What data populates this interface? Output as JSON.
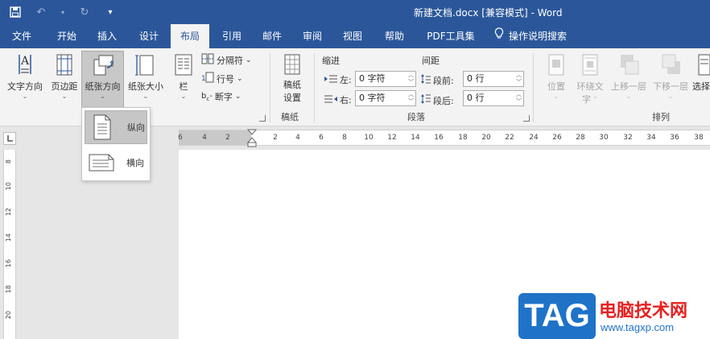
{
  "title_bar": {
    "title": "新建文档.docx [兼容模式]  -  Word",
    "icons": [
      "save-icon",
      "undo-icon",
      "redo-icon",
      "customize-qat-icon"
    ]
  },
  "tabs": [
    {
      "label": "文件"
    },
    {
      "label": "开始"
    },
    {
      "label": "插入"
    },
    {
      "label": "设计"
    },
    {
      "label": "布局"
    },
    {
      "label": "引用"
    },
    {
      "label": "邮件"
    },
    {
      "label": "审阅"
    },
    {
      "label": "视图"
    },
    {
      "label": "帮助"
    },
    {
      "label": "PDF工具集"
    },
    {
      "label": "操作说明搜索"
    }
  ],
  "active_tab": "布局",
  "ribbon": {
    "page_setup": {
      "text_direction": "文字方向",
      "margins": "页边距",
      "orientation": "纸张方向",
      "size": "纸张大小",
      "columns": "栏",
      "breaks": "分隔符",
      "line_numbers": "行号",
      "hyphenation": "断字"
    },
    "manuscript": {
      "button": "稿纸\n设置",
      "button_line1": "稿纸",
      "button_line2": "设置",
      "group_label": "稿纸"
    },
    "paragraph": {
      "indent_header": "缩进",
      "spacing_header": "间距",
      "left_label": "左:",
      "right_label": "右:",
      "before_label": "段前:",
      "after_label": "段后:",
      "left_value": "0 字符",
      "right_value": "0 字符",
      "before_value": "0 行",
      "after_value": "0 行",
      "group_label": "段落"
    },
    "arrange": {
      "position": "位置",
      "wrap_text_line1": "环绕文",
      "wrap_text_line2": "字",
      "bring_forward": "上移一层",
      "send_backward": "下移一层",
      "selection_pane": "选择",
      "group_label": "排列"
    }
  },
  "orientation_menu": {
    "portrait": "纵向",
    "landscape": "横向",
    "selected": "纵向"
  },
  "ruler": {
    "h_ticks": [
      "6",
      "4",
      "2",
      "2",
      "2",
      "4",
      "6",
      "8",
      "10",
      "12",
      "14",
      "16",
      "18",
      "20",
      "22",
      "24",
      "26",
      "28",
      "30",
      "32",
      "34",
      "36",
      "38"
    ],
    "v_ticks": [
      "8",
      "10",
      "12",
      "14",
      "16",
      "18",
      "20"
    ]
  },
  "watermark": {
    "logo_text": "TAG",
    "site_name": "电脑技术网",
    "url": "www.tagxp.com"
  },
  "colors": {
    "accent": "#2b579a",
    "ribbon_bg": "#f3f3f3",
    "watermark_blue": "#1e73c8",
    "watermark_red": "#e82020"
  }
}
